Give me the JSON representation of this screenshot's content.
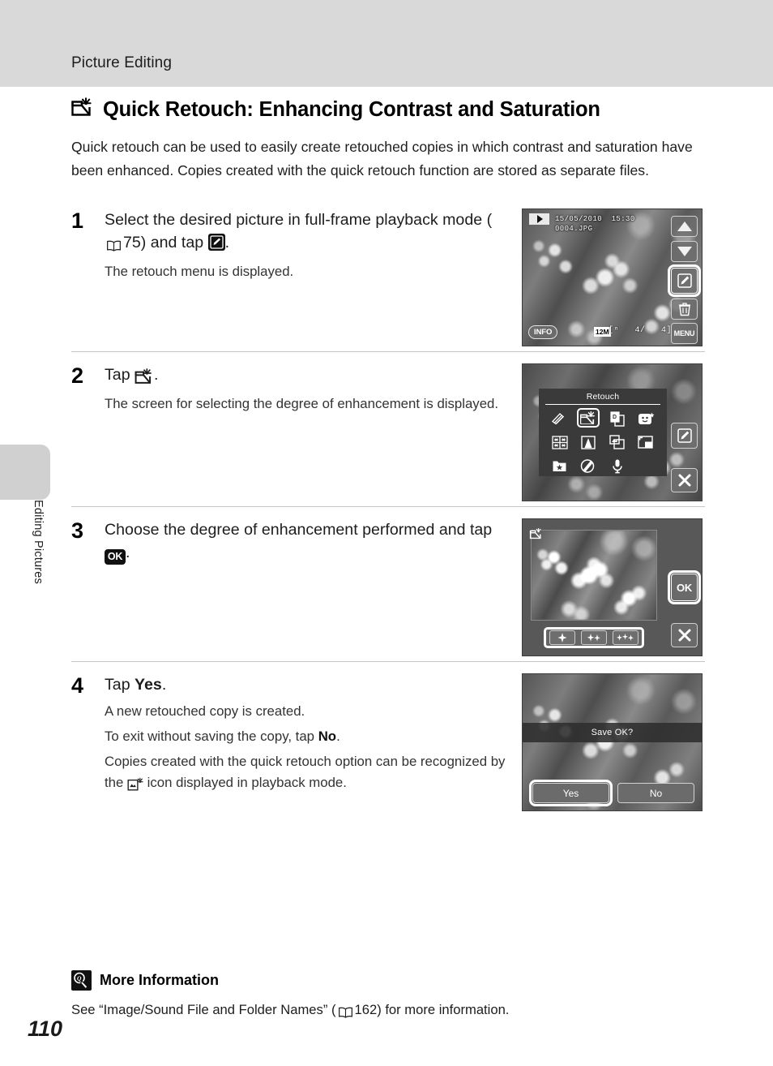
{
  "header": {
    "section": "Picture Editing"
  },
  "side": {
    "chapter": "Editing Pictures"
  },
  "page": {
    "number": "110"
  },
  "heading": {
    "icon": "quick-retouch-icon",
    "title": "Quick Retouch: Enhancing Contrast and Saturation"
  },
  "intro": "Quick retouch can be used to easily create retouched copies in which contrast and saturation have been enhanced. Copies created with the quick retouch function are stored as separate files.",
  "steps": [
    {
      "number": "1",
      "title_a": "Select the desired picture in full-frame playback mode (",
      "ref": "75",
      "title_b": ") and tap ",
      "title_c": ".",
      "note": "The retouch menu is displayed."
    },
    {
      "number": "2",
      "title_a": "Tap ",
      "title_c": ".",
      "note": "The screen for selecting the degree of enhancement is displayed."
    },
    {
      "number": "3",
      "title_a": "Choose the degree of enhancement performed and tap ",
      "ok_label": "OK",
      "title_c": "."
    },
    {
      "number": "4",
      "title_a": "Tap ",
      "title_bold": "Yes",
      "title_c": ".",
      "note1": "A new retouched copy is created.",
      "note2_a": "To exit without saving the copy, tap ",
      "note2_bold": "No",
      "note2_b": ".",
      "note3_a": "Copies created with the quick retouch option can be recognized by the ",
      "note3_b": " icon displayed in playback mode."
    }
  ],
  "screens": {
    "playback": {
      "date": "15/05/2010  15:30",
      "filename": "0004.JPG",
      "quality": "12M",
      "frame_counter": "[ⁿ   4/   4]",
      "info_button": "INFO",
      "menu_button": "MENU",
      "buttons": [
        "scroll-up",
        "scroll-down",
        "retouch",
        "delete",
        "menu"
      ]
    },
    "retouch_menu": {
      "title": "Retouch",
      "selected_index": 1,
      "items": [
        "skin-softening-icon",
        "quick-retouch-icon",
        "d-lighting-icon",
        "smart-portrait-icon",
        "filter-effects-icon",
        "perspective-control-icon",
        "small-picture-icon",
        "crop-icon",
        "favorites-icon",
        "paint-icon",
        "voice-memo-icon"
      ],
      "side_buttons": [
        "retouch",
        "close"
      ]
    },
    "enhance_level": {
      "levels": [
        "level-1",
        "level-2",
        "level-3"
      ],
      "ok_label": "OK",
      "side_buttons": [
        "ok",
        "close"
      ]
    },
    "confirm": {
      "prompt": "Save OK?",
      "yes_label": "Yes",
      "no_label": "No",
      "selected": "Yes"
    }
  },
  "more_information": {
    "icon": "more-information-icon",
    "title": "More Information",
    "body_a": "See “Image/Sound File and Folder Names” (",
    "ref": "162",
    "body_b": ") for more information."
  },
  "colors": {
    "header_band": "#d9d9d9",
    "side_tab": "#d0d0d0",
    "text": "#1d1d1d",
    "rule": "#c6c6c6"
  }
}
